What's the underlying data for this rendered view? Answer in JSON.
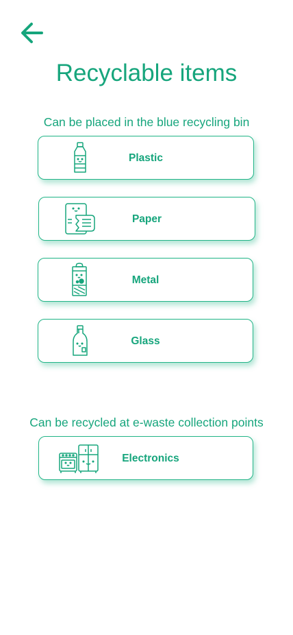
{
  "header": {
    "title": "Recyclable items",
    "back_icon": "arrow-left-icon"
  },
  "colors": {
    "accent": "#16a57c",
    "border": "#22b487"
  },
  "sections": [
    {
      "label": "Can be placed in the blue recycling bin",
      "items": [
        {
          "label": "Plastic",
          "icon": "plastic-bottle-icon"
        },
        {
          "label": "Paper",
          "icon": "paper-icon"
        },
        {
          "label": "Metal",
          "icon": "metal-can-icon"
        },
        {
          "label": "Glass",
          "icon": "glass-bottle-icon"
        }
      ]
    },
    {
      "label": "Can be recycled at e-waste collection points",
      "items": [
        {
          "label": "Electronics",
          "icon": "electronics-icon"
        }
      ]
    }
  ]
}
